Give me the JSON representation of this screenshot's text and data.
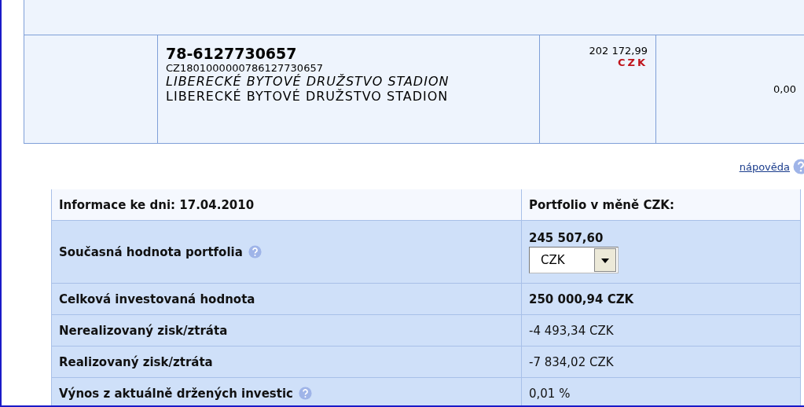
{
  "account_table": {
    "rows": [
      {
        "kind": "empty"
      },
      {
        "kind": "account",
        "account_number": "78-6127730657",
        "iban": "CZ1801000000786127730657",
        "name_italic": "LIBERECKÉ BYTOVÉ DRUŽSTVO STADION",
        "name": "LIBERECKÉ BYTOVÉ DRUŽSTVO STADION",
        "balance": "202 172,99",
        "currency": "CZK",
        "column_4": "0,00"
      }
    ]
  },
  "help_link": "nápověda",
  "portfolio_table": {
    "header": {
      "date_label": "Informace ke dni: 17.04.2010",
      "currency_label": "Portfolio v měně CZK:"
    },
    "rows": [
      {
        "kind": "select",
        "label": "Současná hodnota portfolia",
        "help": true,
        "value": "245 507,60",
        "select_value": "CZK"
      },
      {
        "kind": "bold",
        "label": "Celková investovaná hodnota",
        "help": false,
        "value": "250 000,94 CZK"
      },
      {
        "kind": "plain",
        "label": "Nerealizovaný zisk/ztráta",
        "help": false,
        "value": "-4 493,34 CZK"
      },
      {
        "kind": "plain",
        "label": "Realizovaný zisk/ztráta",
        "help": false,
        "value": "-7 834,02 CZK"
      },
      {
        "kind": "plain",
        "label": "Výnos z aktuálně držených investic",
        "help": true,
        "value": "0,01 %"
      }
    ]
  }
}
